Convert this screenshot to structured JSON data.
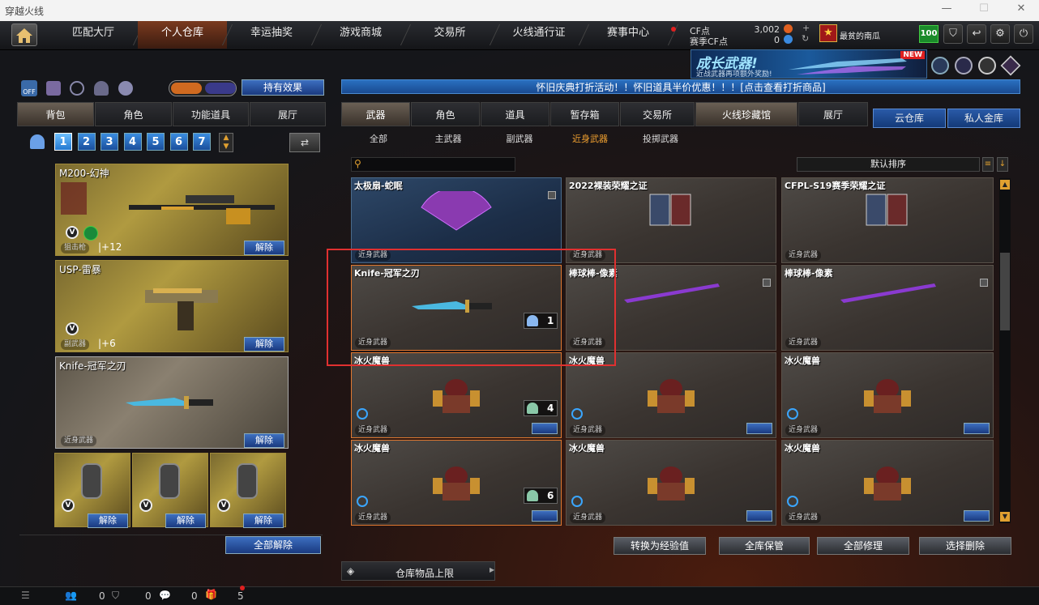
{
  "window": {
    "title": "穿越火线"
  },
  "nav": {
    "tabs": [
      "匹配大厅",
      "个人仓库",
      "幸运抽奖",
      "游戏商城",
      "交易所",
      "火线通行证",
      "赛事中心"
    ],
    "active": 1
  },
  "currency": {
    "cf_label": "CF点",
    "cf_value": "3,002",
    "season_label": "赛季CF点",
    "season_value": "0"
  },
  "user": {
    "name": "最贫的南瓜",
    "level_badge": "100"
  },
  "banner": {
    "title": "成长武器!",
    "subtitle": "近战武器再项额外奖励!",
    "badge": "NEW"
  },
  "left": {
    "effect_button": "持有效果",
    "off_label": "OFF",
    "tabs": [
      "背包",
      "角色",
      "功能道具",
      "展厅"
    ],
    "bag_numbers": [
      "1",
      "2",
      "3",
      "4",
      "5",
      "6",
      "7"
    ],
    "slots": [
      {
        "name": "M200-幻神",
        "type": "狙击枪",
        "bonus": "+12",
        "action": "解除"
      },
      {
        "name": "USP-雷暴",
        "type": "副武器",
        "bonus": "+6",
        "action": "解除"
      },
      {
        "name": "Knife-冠军之刃",
        "type": "近身武器",
        "action": "解除"
      }
    ],
    "grenades": [
      {
        "action": "解除"
      },
      {
        "action": "解除"
      },
      {
        "action": "解除"
      }
    ],
    "unequip_all": "全部解除"
  },
  "notice": "怀旧庆典打折活动！！怀旧道具半价优惠！！！[点击查看打折商品]",
  "right": {
    "tabs": [
      "武器",
      "角色",
      "道具",
      "暂存箱",
      "交易所",
      "火线珍藏馆",
      "展厅"
    ],
    "cloud_tabs": [
      "云仓库",
      "私人金库"
    ],
    "subtabs": [
      "全部",
      "主武器",
      "副武器",
      "近身武器",
      "投掷武器"
    ],
    "sort_label": "默认排序",
    "items": [
      {
        "name": "太极扇-蛇眠",
        "type": "近身武器",
        "style": "blue",
        "lock": true
      },
      {
        "name": "2022裸装荣耀之证",
        "type": "近身武器"
      },
      {
        "name": "CFPL-S19赛季荣耀之证",
        "type": "近身武器"
      },
      {
        "name": "Knife-冠军之刃",
        "type": "近身武器",
        "qty": "1",
        "selected": true
      },
      {
        "name": "棒球棒-像素",
        "type": "近身武器",
        "lock": true
      },
      {
        "name": "棒球棒-像素",
        "type": "近身武器",
        "lock": true
      },
      {
        "name": "冰火魔兽",
        "type": "近身武器",
        "qty": "4",
        "selected": true
      },
      {
        "name": "冰火魔兽",
        "type": "近身武器"
      },
      {
        "name": "冰火魔兽",
        "type": "近身武器"
      },
      {
        "name": "冰火魔兽",
        "type": "近身武器",
        "qty": "6",
        "selected": true
      },
      {
        "name": "冰火魔兽",
        "type": "近身武器"
      },
      {
        "name": "冰火魔兽",
        "type": "近身武器"
      }
    ],
    "actions": [
      "转换为经验值",
      "全库保管",
      "全部修理",
      "选择删除"
    ]
  },
  "storage_limit": "仓库物品上限",
  "bottom": {
    "count1": "0",
    "count2": "0",
    "count3": "0",
    "count4": "5"
  }
}
